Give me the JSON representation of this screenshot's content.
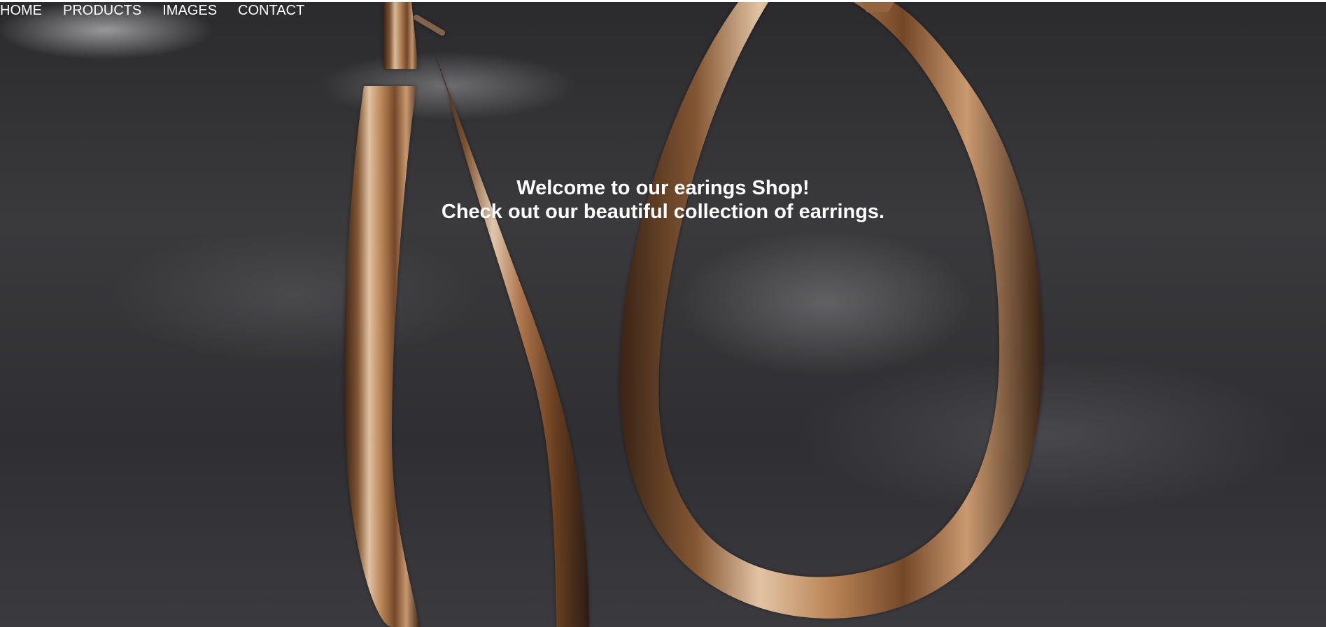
{
  "nav": {
    "items": [
      {
        "label": "HOME"
      },
      {
        "label": "PRODUCTS"
      },
      {
        "label": "IMAGES"
      },
      {
        "label": "CONTACT"
      }
    ]
  },
  "hero": {
    "line1": "Welcome to our earings Shop!",
    "line2": "Check out our beautiful collection of earrings.",
    "text_color": "#ffffff",
    "metal_color": "#b98a5b",
    "background_color": "#2f2f33"
  }
}
